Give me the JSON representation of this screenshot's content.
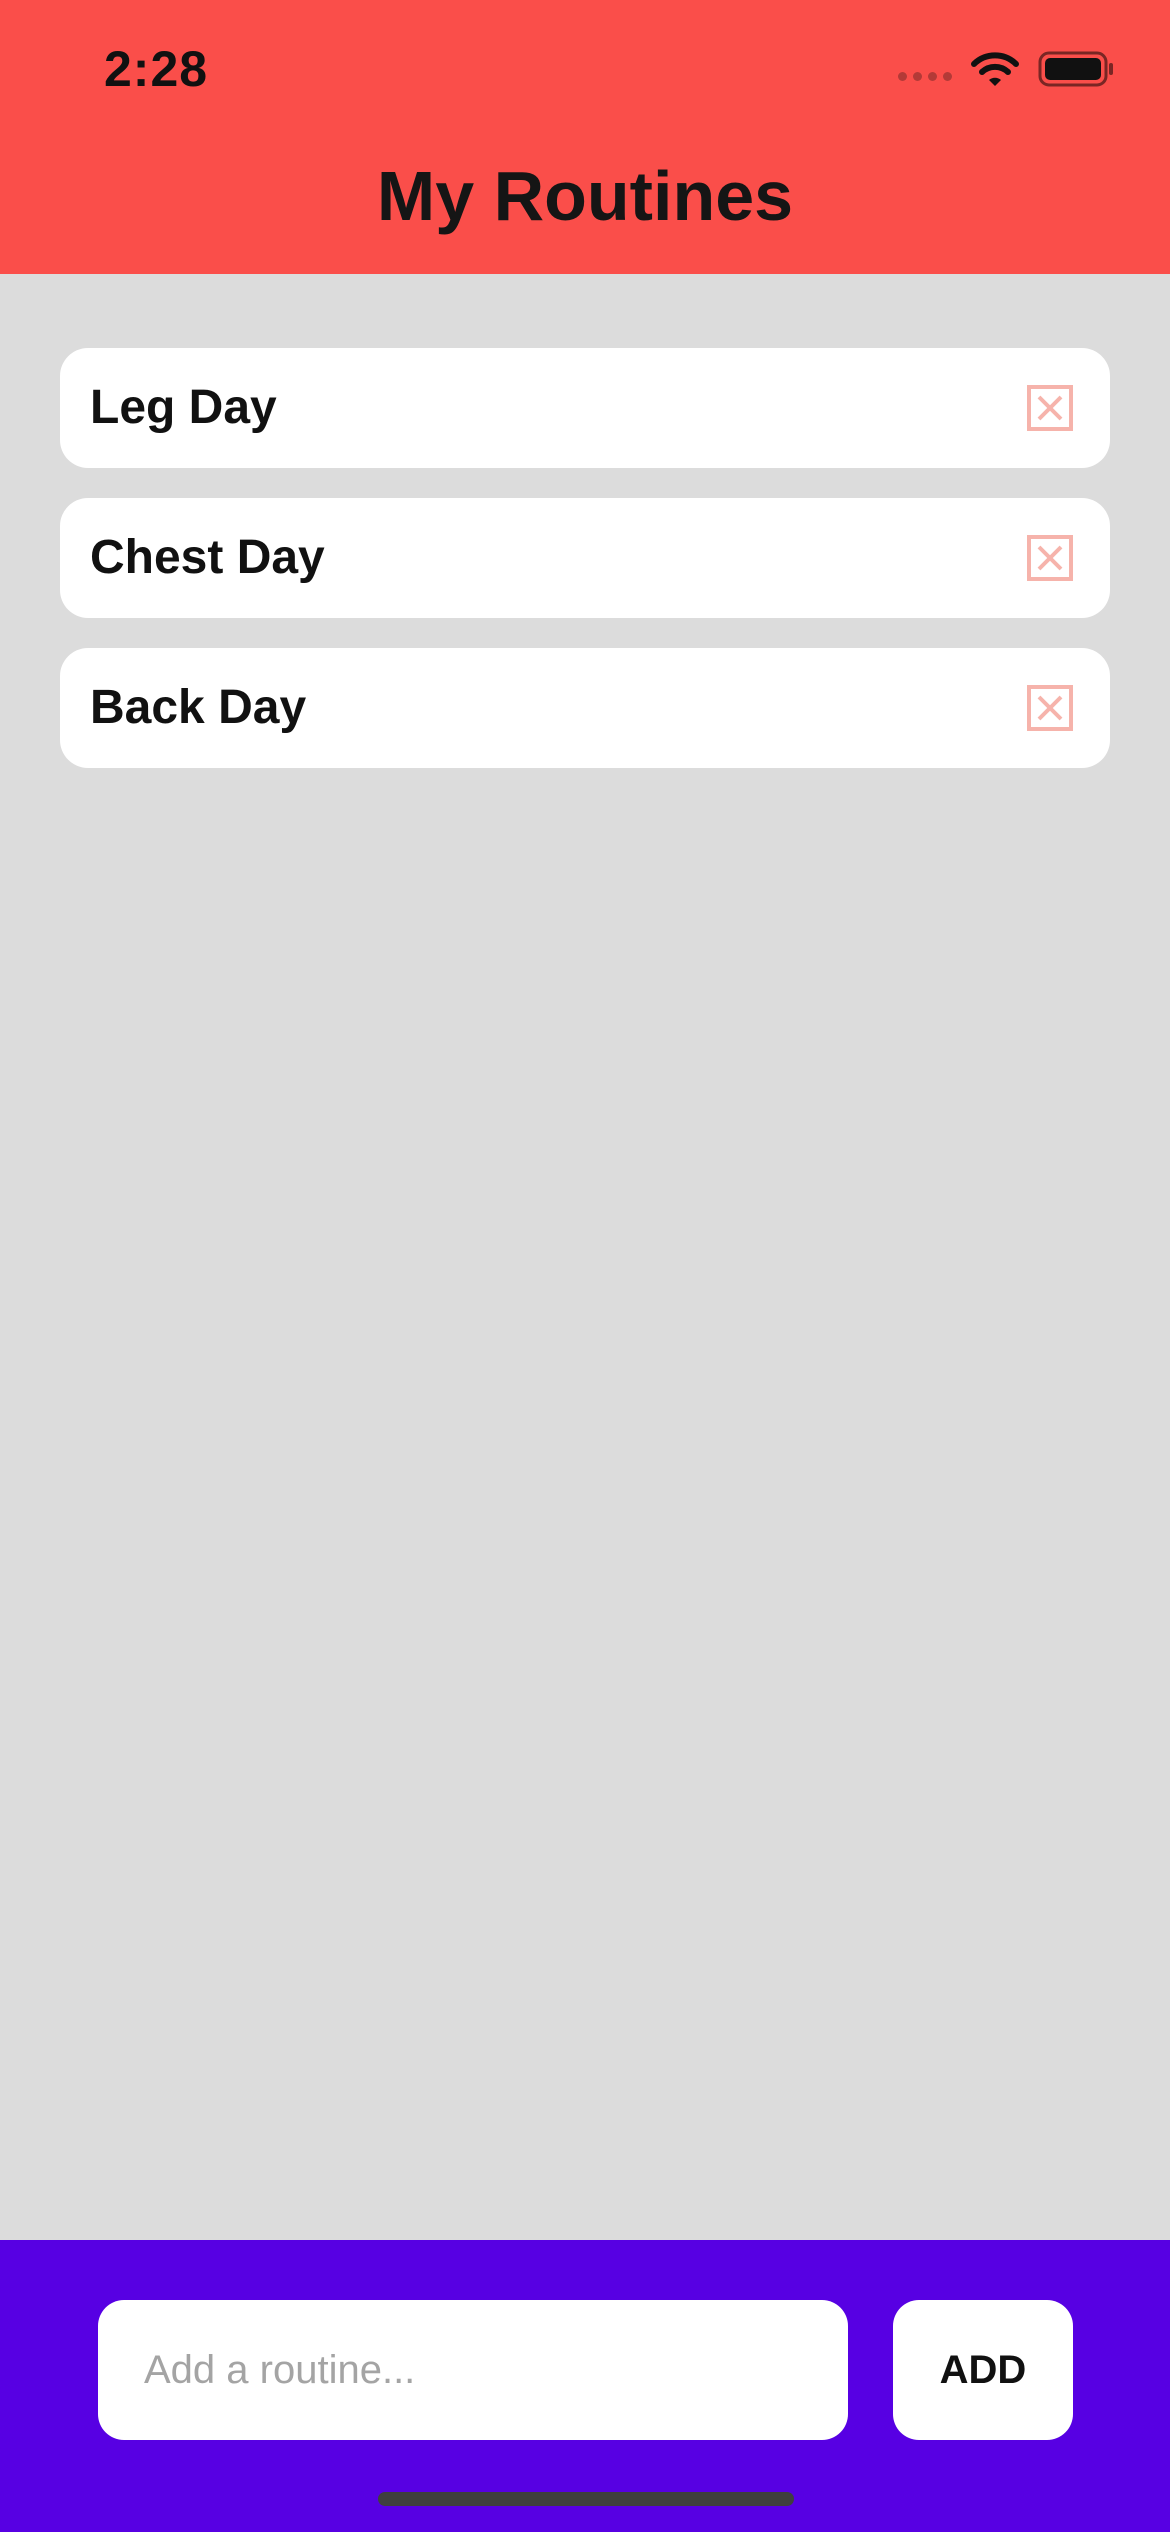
{
  "status_bar": {
    "time": "2:28",
    "icons": [
      "cellular-signal-icon",
      "wifi-icon",
      "battery-icon"
    ]
  },
  "header": {
    "title": "My Routines"
  },
  "routines": [
    {
      "name": "Leg Day",
      "delete_icon": "close-box-icon"
    },
    {
      "name": "Chest Day",
      "delete_icon": "close-box-icon"
    },
    {
      "name": "Back Day",
      "delete_icon": "close-box-icon"
    }
  ],
  "composer": {
    "input_value": "",
    "placeholder": "Add a routine...",
    "add_label": "ADD"
  },
  "colors": {
    "header": "#fa4e4a",
    "background": "#dcdcdc",
    "bottom_bar": "#5700e3",
    "delete_icon": "#f6b3ab"
  }
}
